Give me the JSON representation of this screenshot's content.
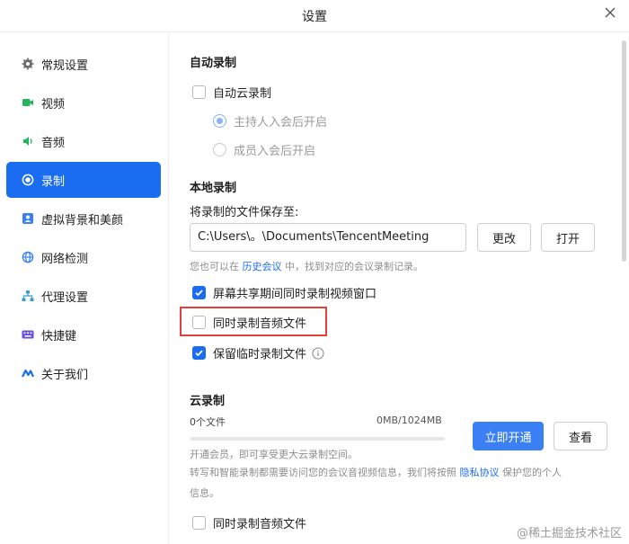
{
  "window": {
    "title": "设置"
  },
  "sidebar": {
    "items": [
      {
        "label": "常规设置",
        "icon": "gear-icon"
      },
      {
        "label": "视频",
        "icon": "video-camera-icon"
      },
      {
        "label": "音频",
        "icon": "speaker-icon"
      },
      {
        "label": "录制",
        "icon": "record-icon",
        "active": true
      },
      {
        "label": "虚拟背景和美颜",
        "icon": "portrait-icon"
      },
      {
        "label": "网络检测",
        "icon": "globe-icon"
      },
      {
        "label": "代理设置",
        "icon": "network-tree-icon"
      },
      {
        "label": "快捷键",
        "icon": "keyboard-icon"
      },
      {
        "label": "关于我们",
        "icon": "tencent-meeting-logo-icon"
      }
    ]
  },
  "auto_record": {
    "title": "自动录制",
    "cloud_checkbox": {
      "label": "自动云录制",
      "checked": false
    },
    "radio_host": {
      "label": "主持人入会后开启",
      "selected": true
    },
    "radio_member": {
      "label": "成员入会后开启",
      "selected": false
    }
  },
  "local_record": {
    "title": "本地录制",
    "save_to_label": "将录制的文件保存至:",
    "path_value": "C:\\Users\\。\\Documents\\TencentMeeting",
    "change_button": "更改",
    "open_button": "打开",
    "hint_prefix": "您也可以在",
    "hint_link": "历史会议",
    "hint_suffix": "中，找到对应的会议录制记录。",
    "opt_screen_share": {
      "label": "屏幕共享期间同时录制视频窗口",
      "checked": true
    },
    "opt_audio_file": {
      "label": "同时录制音频文件",
      "checked": false
    },
    "opt_keep_temp": {
      "label": "保留临时录制文件",
      "checked": true
    }
  },
  "cloud_record": {
    "title": "云录制",
    "file_count": "0个文件",
    "usage": "0MB/1024MB",
    "usage_fraction": 0,
    "activate_button": "立即开通",
    "view_button": "查看",
    "member_hint": "开通会员，即可享受更大云录制空间。",
    "privacy_prefix": "转写和智能录制都需要访问您的会议音视频信息，我们将按照",
    "privacy_link": "隐私协议",
    "privacy_suffix": "保护您的个人",
    "privacy_line2": "信息。",
    "opt_audio_file": {
      "label": "同时录制音频文件",
      "checked": false
    }
  },
  "watermark": "@稀土掘金技术社区",
  "colors": {
    "accent": "#1a6cf0",
    "highlight": "#e3403b"
  }
}
